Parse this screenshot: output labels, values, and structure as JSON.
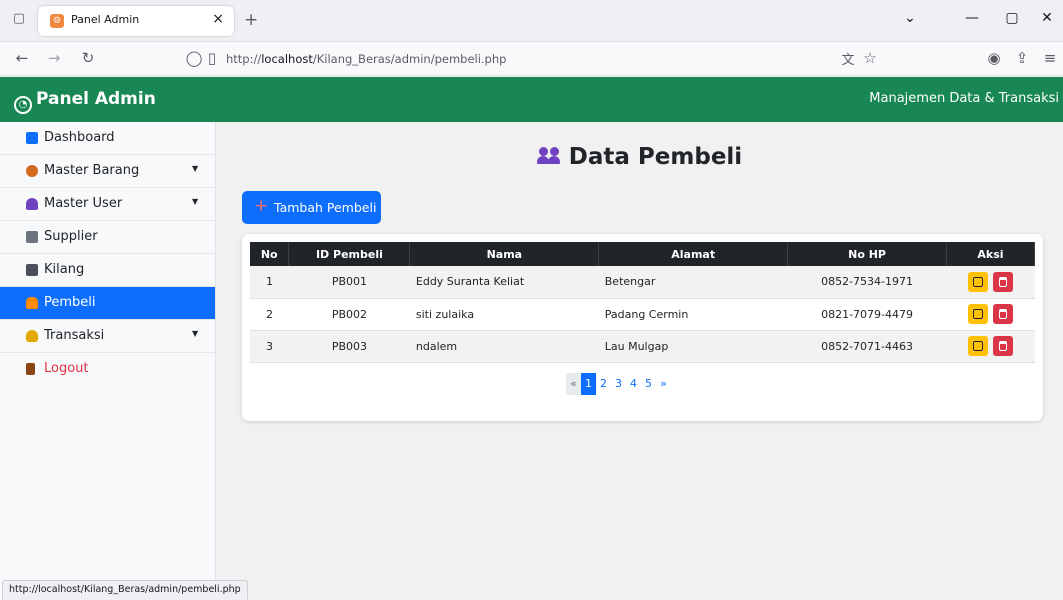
{
  "browser": {
    "tab_title": "Panel Admin",
    "tab_close": "×",
    "new_tab": "+",
    "url_prefix": "http://",
    "url_host": "localhost",
    "url_path": "/Kilang_Beras/admin/pembeli.php",
    "status_url": "http://localhost/Kilang_Beras/admin/pembeli.php"
  },
  "header": {
    "brand": "Panel Admin",
    "subtitle": "Manajemen Data & Transaksi",
    "color": "#198754"
  },
  "sidebar": {
    "items": [
      {
        "label": "Dashboard",
        "icon": "bar-chart-icon",
        "color": "#0d6efd"
      },
      {
        "label": "Master Barang",
        "icon": "box-icon",
        "color": "#d2691e"
      },
      {
        "label": "Master User",
        "icon": "users-icon",
        "color": "#6f42c1"
      },
      {
        "label": "Supplier",
        "icon": "factory-icon",
        "color": "#6c757d"
      },
      {
        "label": "Kilang",
        "icon": "building-icon",
        "color": "#495057"
      },
      {
        "label": "Pembeli",
        "icon": "people-icon",
        "color": "#ff8c00"
      },
      {
        "label": "Transaksi",
        "icon": "money-bag-icon",
        "color": "#e0a800"
      },
      {
        "label": "Logout",
        "icon": "door-icon",
        "color": "#8b4513"
      }
    ],
    "caret": "▼"
  },
  "main": {
    "title": "Data Pembeli",
    "add_button": "Tambah Pembeli",
    "add_plus": "+"
  },
  "table": {
    "headers": [
      "No",
      "ID Pembeli",
      "Nama",
      "Alamat",
      "No HP",
      "Aksi"
    ],
    "rows": [
      {
        "no": "1",
        "id": "PB001",
        "nama": "Eddy Suranta Keliat",
        "alamat": "Betengar",
        "hp": "0852-7534-1971"
      },
      {
        "no": "2",
        "id": "PB002",
        "nama": "siti zulaika",
        "alamat": "Padang Cermin",
        "hp": "0821-7079-4479"
      },
      {
        "no": "3",
        "id": "PB003",
        "nama": "ndalem",
        "alamat": "Lau Mulgap",
        "hp": "0852-7071-4463"
      }
    ]
  },
  "pagination": {
    "prev": "«",
    "pages": [
      "1",
      "2",
      "3",
      "4",
      "5"
    ],
    "next": "»",
    "active": "1"
  }
}
